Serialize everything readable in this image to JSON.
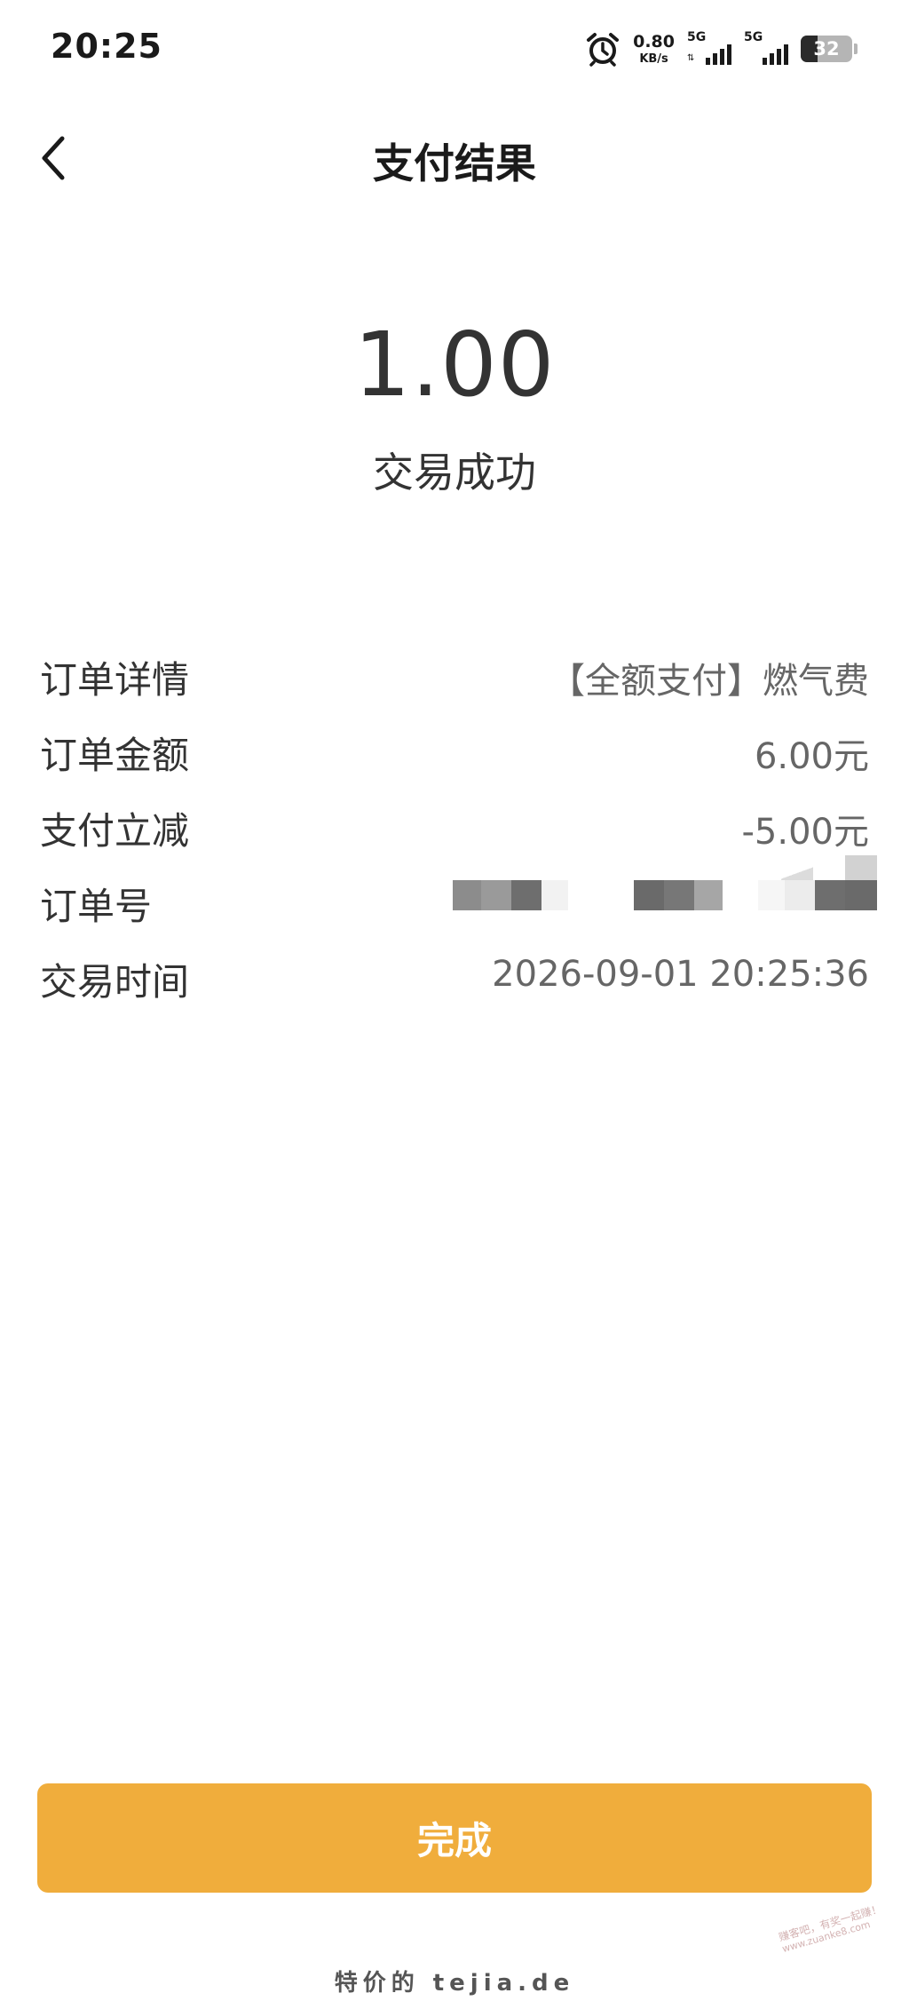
{
  "status_bar": {
    "time": "20:25",
    "alarm_icon": "alarm-clock-icon",
    "net_speed_value": "0.80",
    "net_speed_unit": "KB/s",
    "sim1_network": "5G",
    "sim2_network": "5G",
    "battery_level": "32"
  },
  "header": {
    "back_icon": "chevron-left-icon",
    "title": "支付结果"
  },
  "result": {
    "amount": "1.00",
    "status": "交易成功"
  },
  "details": [
    {
      "label": "订单详情",
      "value": "【全额支付】燃气费"
    },
    {
      "label": "订单金额",
      "value": "6.00元"
    },
    {
      "label": "支付立减",
      "value": "-5.00元"
    },
    {
      "label": "订单号",
      "value": ""
    },
    {
      "label": "交易时间",
      "value": "2026-09-01 20:25:36"
    }
  ],
  "actions": {
    "done_label": "完成"
  },
  "watermarks": {
    "bottom": "特价的 tejia.de",
    "corner_line1": "赚客吧，有奖一起赚！",
    "corner_line2": "www.zuanke8.com"
  },
  "colors": {
    "accent": "#f0ad3c",
    "text_primary": "#333333",
    "text_secondary": "#666666",
    "background": "#ffffff"
  }
}
